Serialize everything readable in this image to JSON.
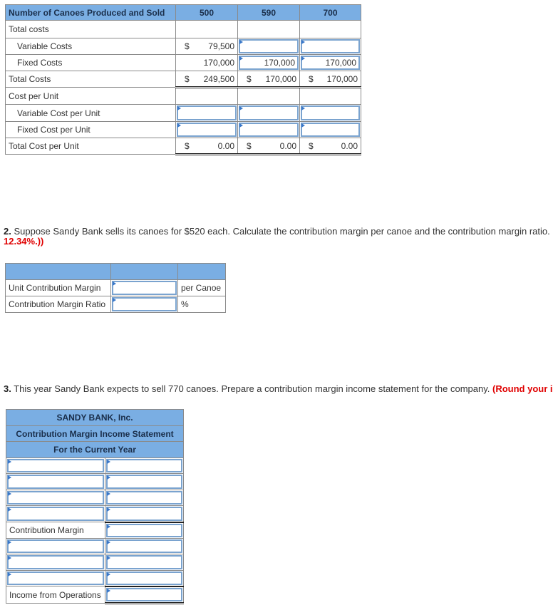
{
  "cost_table": {
    "header_label": "Number of Canoes Produced and Sold",
    "columns": [
      "500",
      "590",
      "700"
    ],
    "rows": {
      "total_costs_heading": "Total costs",
      "variable_costs": {
        "label": "Variable Costs",
        "currency": "$",
        "values": [
          "79,500",
          "",
          ""
        ]
      },
      "fixed_costs": {
        "label": "Fixed Costs",
        "values": [
          "170,000",
          "170,000",
          "170,000"
        ]
      },
      "total_costs": {
        "label": "Total Costs",
        "currency": "$",
        "values": [
          "249,500",
          "170,000",
          "170,000"
        ]
      },
      "cost_per_unit_heading": "Cost per Unit",
      "variable_cost_per_unit": {
        "label": "Variable Cost per Unit",
        "values": [
          "",
          "",
          ""
        ]
      },
      "fixed_cost_per_unit": {
        "label": "Fixed Cost per Unit",
        "values": [
          "",
          "",
          ""
        ]
      },
      "total_cost_per_unit": {
        "label": "Total Cost per Unit",
        "currency": "$",
        "values": [
          "0.00",
          "0.00",
          "0.00"
        ]
      }
    }
  },
  "question2": {
    "number": "2.",
    "text": " Suppose Sandy Bank sells its canoes for $520 each. Calculate the contribution margin per canoe and the contribution margin ratio. ",
    "note": "12.34%.))"
  },
  "cm_table": {
    "rows": [
      {
        "label": "Unit Contribution Margin",
        "value": "",
        "unit": "per Canoe"
      },
      {
        "label": "Contribution Margin Ratio",
        "value": "",
        "unit": "%"
      }
    ]
  },
  "question3": {
    "number": "3.",
    "text": " This year Sandy Bank expects to sell 770 canoes. Prepare a contribution margin income statement for the company. ",
    "note": "(Round your i"
  },
  "income_statement": {
    "company": "SANDY BANK, Inc.",
    "title": "Contribution Margin Income Statement",
    "period": "For the Current Year",
    "contribution_margin_label": "Contribution Margin",
    "income_label": "Income from Operations"
  }
}
